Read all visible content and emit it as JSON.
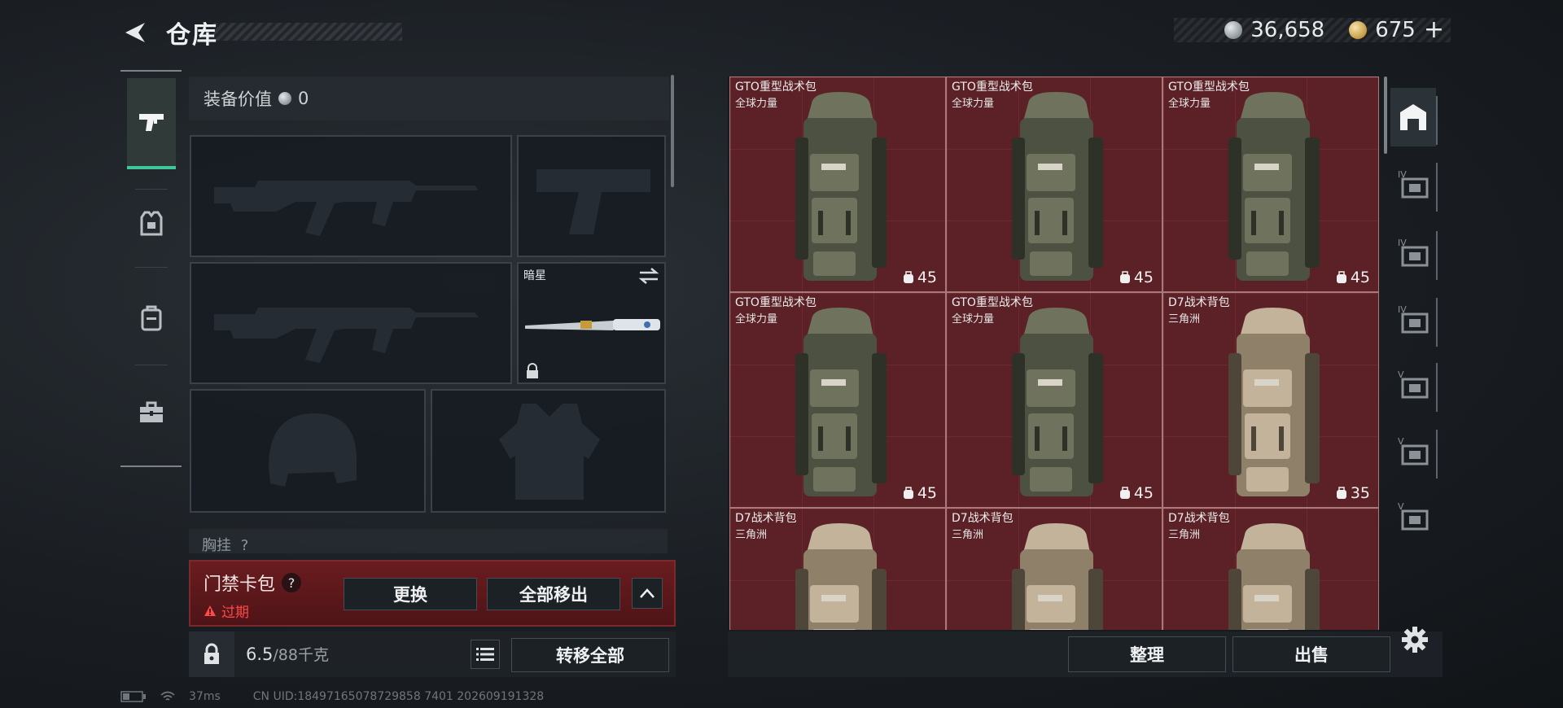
{
  "header": {
    "title": "仓库",
    "currency_silver": "36,658",
    "currency_gold": "675",
    "plus_label": "+"
  },
  "loadout": {
    "equip_value_label": "装备价值",
    "equip_value": "0",
    "melee_label": "暗星",
    "chest_label": "胸挂",
    "chest_help": "?"
  },
  "keycard": {
    "title": "门禁卡包",
    "help": "?",
    "status": "过期",
    "replace_label": "更换",
    "remove_all_label": "全部移出"
  },
  "capacity": {
    "current": "6.5",
    "max": "/88千克"
  },
  "transfer_all_label": "转移全部",
  "status_bar": {
    "ping": "37ms",
    "uid": "CN UID:18497165078729858 7401 202609191328"
  },
  "storage": {
    "items": [
      {
        "name": "GTO重型战术包",
        "brand": "全球力量",
        "durability": "45",
        "color": "olive"
      },
      {
        "name": "GTO重型战术包",
        "brand": "全球力量",
        "durability": "45",
        "color": "olive"
      },
      {
        "name": "GTO重型战术包",
        "brand": "全球力量",
        "durability": "45",
        "color": "olive"
      },
      {
        "name": "GTO重型战术包",
        "brand": "全球力量",
        "durability": "45",
        "color": "olive"
      },
      {
        "name": "GTO重型战术包",
        "brand": "全球力量",
        "durability": "45",
        "color": "olive"
      },
      {
        "name": "D7战术背包",
        "brand": "三角洲",
        "durability": "35",
        "color": "tan"
      },
      {
        "name": "D7战术背包",
        "brand": "三角洲",
        "durability": "",
        "color": "tan"
      },
      {
        "name": "D7战术背包",
        "brand": "三角洲",
        "durability": "",
        "color": "tan"
      },
      {
        "name": "D7战术背包",
        "brand": "三角洲",
        "durability": "",
        "color": "tan"
      }
    ],
    "sort_label": "整理",
    "sell_label": "出售"
  },
  "right_tabs": [
    {
      "icon": "storage-home-icon",
      "badge": ""
    },
    {
      "icon": "storage-tab-icon",
      "badge": "IV"
    },
    {
      "icon": "storage-add-icon",
      "badge": "IV"
    },
    {
      "icon": "storage-folder-icon",
      "badge": "IV"
    },
    {
      "icon": "storage-safe-icon",
      "badge": "V"
    },
    {
      "icon": "storage-safe-icon",
      "badge": "V"
    },
    {
      "icon": "storage-safe-icon",
      "badge": "V"
    }
  ],
  "colors": {
    "accent_green": "#3fc79b",
    "alert_red": "#ff4a4a",
    "cell_red": "#5b2126",
    "keycard_red": "#6a1c1f"
  }
}
